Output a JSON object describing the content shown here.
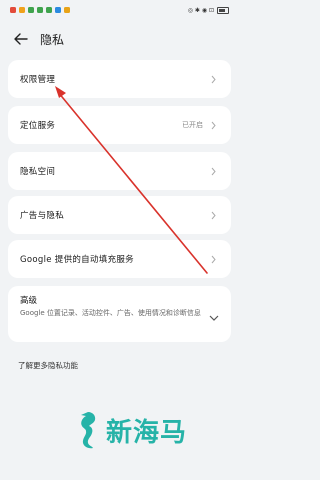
{
  "status_bar": {
    "right_text": "◎ ✱ ◉ ⊡"
  },
  "header": {
    "title": "隐私"
  },
  "rows": [
    {
      "label": "权限管理"
    },
    {
      "label": "定位服务",
      "value": "已开启"
    },
    {
      "label": "隐私空间"
    },
    {
      "label": "广告与隐私"
    },
    {
      "label": "Google 提供的自动填充服务"
    }
  ],
  "advanced": {
    "title": "高级",
    "description": "Google 位置记录、活动控件、广告、使用情况和诊断信息"
  },
  "more_link": "了解更多隐私功能",
  "watermark": {
    "text": "新海马"
  },
  "annotation": {
    "color": "#d9332c"
  },
  "icons": {
    "back": "back-arrow-icon",
    "chevron": "chevron-right-icon",
    "chevron_down": "chevron-down-icon"
  }
}
